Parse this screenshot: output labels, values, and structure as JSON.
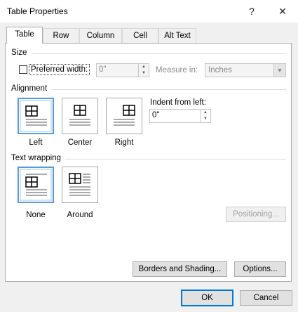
{
  "window": {
    "title": "Table Properties",
    "help": "?",
    "close": "✕"
  },
  "tabs": [
    {
      "label": "Table",
      "active": true
    },
    {
      "label": "Row",
      "active": false
    },
    {
      "label": "Column",
      "active": false
    },
    {
      "label": "Cell",
      "active": false
    },
    {
      "label": "Alt Text",
      "active": false
    }
  ],
  "size": {
    "heading": "Size",
    "preferred_width_label": "Preferred width:",
    "preferred_width_checked": false,
    "preferred_width_value": "0\"",
    "measure_in_label": "Measure in:",
    "measure_in_value": "Inches"
  },
  "alignment": {
    "heading": "Alignment",
    "options": [
      {
        "label": "Left",
        "selected": true
      },
      {
        "label": "Center",
        "selected": false
      },
      {
        "label": "Right",
        "selected": false
      }
    ],
    "indent_label": "Indent from left:",
    "indent_value": "0\""
  },
  "text_wrapping": {
    "heading": "Text wrapping",
    "options": [
      {
        "label": "None",
        "selected": true
      },
      {
        "label": "Around",
        "selected": false
      }
    ],
    "positioning_label": "Positioning..."
  },
  "buttons": {
    "borders_shading": "Borders and Shading...",
    "options": "Options...",
    "ok": "OK",
    "cancel": "Cancel"
  },
  "colors": {
    "accent": "#0078d7",
    "selection": "#5b9bd5"
  }
}
